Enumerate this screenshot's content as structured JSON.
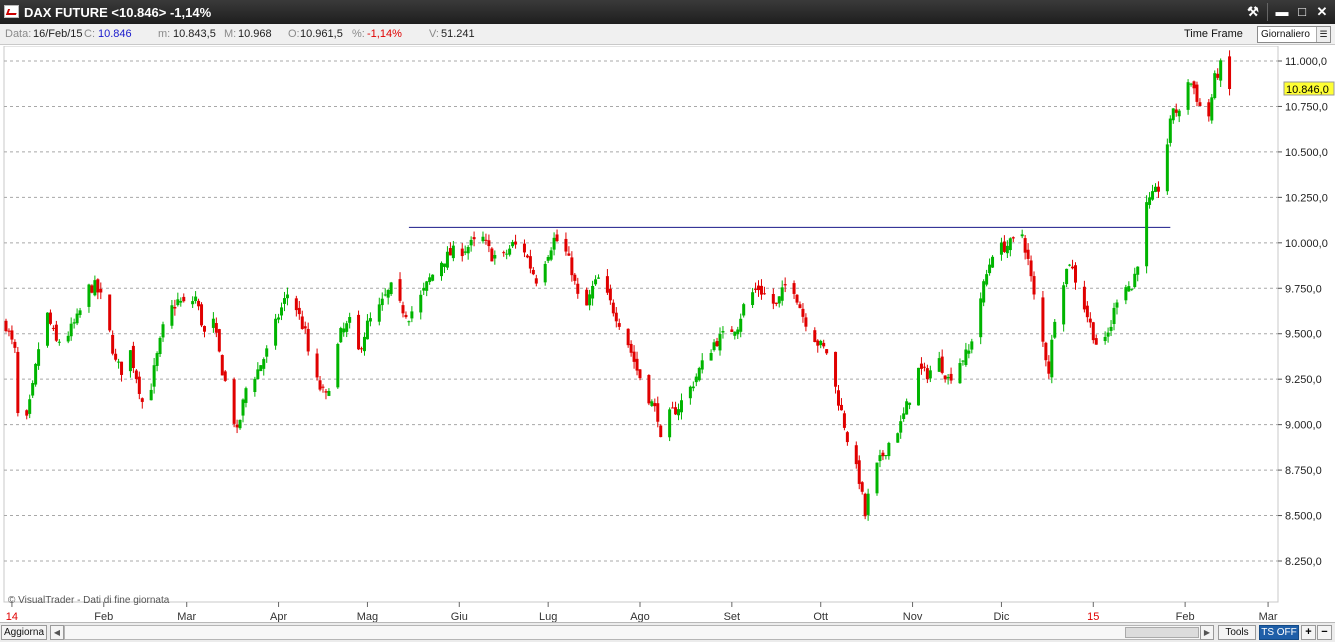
{
  "window": {
    "title": "DAX FUTURE <10.846> -1,14%",
    "controls": {
      "tools": "⚒",
      "minimize": "▬",
      "maximize": "□",
      "close": "✕"
    }
  },
  "infobar": {
    "date_label": "Data:",
    "date_value": "16/Feb/15",
    "close_label": "C:",
    "close_value": "10.846",
    "min_label": "m:",
    "min_value": "10.843,5",
    "max_label": "M:",
    "max_value": "10.968",
    "open_label": "O:",
    "open_value": "10.961,5",
    "pct_label": "%:",
    "pct_value": "-1,14%",
    "vol_label": "V:",
    "vol_value": "51.241",
    "timeframe_label": "Time Frame",
    "timeframe_value": "Giornaliero"
  },
  "bottombar": {
    "refresh": "Aggiorna",
    "tools": "Tools",
    "ts": "TS OFF",
    "plus": "+",
    "minus": "−"
  },
  "chart_data": {
    "type": "candlestick",
    "watermark": "© VisualTrader - Dati di fine giornata",
    "ylim": [
      8100,
      11100
    ],
    "y_ticks": [
      8250,
      8500,
      8750,
      9000,
      9250,
      9500,
      9750,
      10000,
      10250,
      10500,
      10750,
      11000
    ],
    "y_tick_labels": [
      "8.250,0",
      "8.500,0",
      "8.750,0",
      "9.000,0",
      "9.250,0",
      "9.500,0",
      "9.750,0",
      "10.000,0",
      "10.250,0",
      "10.500,0",
      "10.750,0",
      "11.000,0"
    ],
    "grid": true,
    "last_price": 10846,
    "last_price_label": "10.846,0",
    "up_color": "#00b400",
    "down_color": "#e00000",
    "x_range": [
      "2013-12-30",
      "2015-03-03"
    ],
    "x_ticks": [
      {
        "label": "14",
        "date": "2014-01-01",
        "red": true
      },
      {
        "label": "Feb",
        "date": "2014-02-01"
      },
      {
        "label": "Mar",
        "date": "2014-03-01"
      },
      {
        "label": "Apr",
        "date": "2014-04-01"
      },
      {
        "label": "Mag",
        "date": "2014-05-01"
      },
      {
        "label": "Giu",
        "date": "2014-06-01"
      },
      {
        "label": "Lug",
        "date": "2014-07-01"
      },
      {
        "label": "Ago",
        "date": "2014-08-01"
      },
      {
        "label": "Set",
        "date": "2014-09-01"
      },
      {
        "label": "Ott",
        "date": "2014-10-01"
      },
      {
        "label": "Nov",
        "date": "2014-11-01"
      },
      {
        "label": "Dic",
        "date": "2014-12-01"
      },
      {
        "label": "15",
        "date": "2015-01-01",
        "red": true
      },
      {
        "label": "Feb",
        "date": "2015-02-01"
      },
      {
        "label": "Mar",
        "date": "2015-03-01"
      }
    ],
    "trendline": {
      "x1": "2014-05-15",
      "x2": "2015-01-27",
      "y": 10085
    },
    "close_path": [
      [
        "2013-12-30",
        9550
      ],
      [
        "2014-01-02",
        9400
      ],
      [
        "2014-01-03",
        9050
      ],
      [
        "2014-01-06",
        9020
      ],
      [
        "2014-01-08",
        9200
      ],
      [
        "2014-01-10",
        9420
      ],
      [
        "2014-01-13",
        9600
      ],
      [
        "2014-01-16",
        9450
      ],
      [
        "2014-01-20",
        9500
      ],
      [
        "2014-01-23",
        9580
      ],
      [
        "2014-01-27",
        9750
      ],
      [
        "2014-01-29",
        9760
      ],
      [
        "2014-01-31",
        9700
      ],
      [
        "2014-02-03",
        9500
      ],
      [
        "2014-02-05",
        9340
      ],
      [
        "2014-02-07",
        9300
      ],
      [
        "2014-02-10",
        9400
      ],
      [
        "2014-02-13",
        9200
      ],
      [
        "2014-02-15",
        9050
      ],
      [
        "2014-02-18",
        9300
      ],
      [
        "2014-02-22",
        9600
      ],
      [
        "2014-02-26",
        9680
      ],
      [
        "2014-03-01",
        9650
      ],
      [
        "2014-03-04",
        9700
      ],
      [
        "2014-03-07",
        9500
      ],
      [
        "2014-03-10",
        9560
      ],
      [
        "2014-03-13",
        9300
      ],
      [
        "2014-03-16",
        9100
      ],
      [
        "2014-03-18",
        8950
      ],
      [
        "2014-03-21",
        9200
      ],
      [
        "2014-03-25",
        9300
      ],
      [
        "2014-03-28",
        9400
      ],
      [
        "2014-04-01",
        9600
      ],
      [
        "2014-04-04",
        9720
      ],
      [
        "2014-04-07",
        9640
      ],
      [
        "2014-04-10",
        9500
      ],
      [
        "2014-04-12",
        9300
      ],
      [
        "2014-04-15",
        9200
      ],
      [
        "2014-04-17",
        9150
      ],
      [
        "2014-04-22",
        9500
      ],
      [
        "2014-04-25",
        9560
      ],
      [
        "2014-04-28",
        9400
      ],
      [
        "2014-05-01",
        9550
      ],
      [
        "2014-05-05",
        9640
      ],
      [
        "2014-05-07",
        9700
      ],
      [
        "2014-05-09",
        9750
      ],
      [
        "2014-05-12",
        9650
      ],
      [
        "2014-05-15",
        9600
      ],
      [
        "2014-05-19",
        9700
      ],
      [
        "2014-05-22",
        9800
      ],
      [
        "2014-05-26",
        9900
      ],
      [
        "2014-05-30",
        9950
      ],
      [
        "2014-06-02",
        9960
      ],
      [
        "2014-06-05",
        9990
      ],
      [
        "2014-06-09",
        10020
      ],
      [
        "2014-06-12",
        9930
      ],
      [
        "2014-06-16",
        9920
      ],
      [
        "2014-06-19",
        9990
      ],
      [
        "2014-06-23",
        9960
      ],
      [
        "2014-06-25",
        9870
      ],
      [
        "2014-06-27",
        9800
      ],
      [
        "2014-07-01",
        9950
      ],
      [
        "2014-07-03",
        10020
      ],
      [
        "2014-07-06",
        9990
      ],
      [
        "2014-07-09",
        9850
      ],
      [
        "2014-07-11",
        9700
      ],
      [
        "2014-07-14",
        9650
      ],
      [
        "2014-07-16",
        9750
      ],
      [
        "2014-07-18",
        9800
      ],
      [
        "2014-07-21",
        9700
      ],
      [
        "2014-07-24",
        9600
      ],
      [
        "2014-07-27",
        9500
      ],
      [
        "2014-07-31",
        9300
      ],
      [
        "2014-08-04",
        9150
      ],
      [
        "2014-08-07",
        9050
      ],
      [
        "2014-08-08",
        8900
      ],
      [
        "2014-08-11",
        9050
      ],
      [
        "2014-08-14",
        9100
      ],
      [
        "2014-08-18",
        9200
      ],
      [
        "2014-08-21",
        9300
      ],
      [
        "2014-08-26",
        9450
      ],
      [
        "2014-08-30",
        9500
      ],
      [
        "2014-09-03",
        9550
      ],
      [
        "2014-09-06",
        9700
      ],
      [
        "2014-09-10",
        9750
      ],
      [
        "2014-09-13",
        9700
      ],
      [
        "2014-09-16",
        9650
      ],
      [
        "2014-09-20",
        9800
      ],
      [
        "2014-09-22",
        9750
      ],
      [
        "2014-09-25",
        9600
      ],
      [
        "2014-09-30",
        9450
      ],
      [
        "2014-10-03",
        9400
      ],
      [
        "2014-10-06",
        9200
      ],
      [
        "2014-10-09",
        9000
      ],
      [
        "2014-10-11",
        8850
      ],
      [
        "2014-10-14",
        8700
      ],
      [
        "2014-10-16",
        8500
      ],
      [
        "2014-10-18",
        8700
      ],
      [
        "2014-10-21",
        8800
      ],
      [
        "2014-10-24",
        8900
      ],
      [
        "2014-10-28",
        9000
      ],
      [
        "2014-10-31",
        9150
      ],
      [
        "2014-11-03",
        9300
      ],
      [
        "2014-11-06",
        9280
      ],
      [
        "2014-11-10",
        9350
      ],
      [
        "2014-11-13",
        9250
      ],
      [
        "2014-11-17",
        9350
      ],
      [
        "2014-11-20",
        9400
      ],
      [
        "2014-11-24",
        9700
      ],
      [
        "2014-11-28",
        9950
      ],
      [
        "2014-12-02",
        9980
      ],
      [
        "2014-12-05",
        10000
      ],
      [
        "2014-12-08",
        10050
      ],
      [
        "2014-12-10",
        9900
      ],
      [
        "2014-12-12",
        9700
      ],
      [
        "2014-12-15",
        9450
      ],
      [
        "2014-12-17",
        9300
      ],
      [
        "2014-12-19",
        9600
      ],
      [
        "2014-12-22",
        9800
      ],
      [
        "2014-12-24",
        9900
      ],
      [
        "2014-12-29",
        9650
      ],
      [
        "2015-01-02",
        9450
      ],
      [
        "2015-01-05",
        9450
      ],
      [
        "2015-01-07",
        9550
      ],
      [
        "2015-01-09",
        9700
      ],
      [
        "2015-01-12",
        9780
      ],
      [
        "2015-01-14",
        9750
      ],
      [
        "2015-01-16",
        9900
      ],
      [
        "2015-01-19",
        10200
      ],
      [
        "2015-01-21",
        10250
      ],
      [
        "2015-01-23",
        10300
      ],
      [
        "2015-01-26",
        10550
      ],
      [
        "2015-01-28",
        10750
      ],
      [
        "2015-01-30",
        10700
      ],
      [
        "2015-02-02",
        10900
      ],
      [
        "2015-02-04",
        10850
      ],
      [
        "2015-02-06",
        10750
      ],
      [
        "2015-02-09",
        10700
      ],
      [
        "2015-02-11",
        10900
      ],
      [
        "2015-02-13",
        10970
      ],
      [
        "2015-02-16",
        10846
      ]
    ]
  }
}
